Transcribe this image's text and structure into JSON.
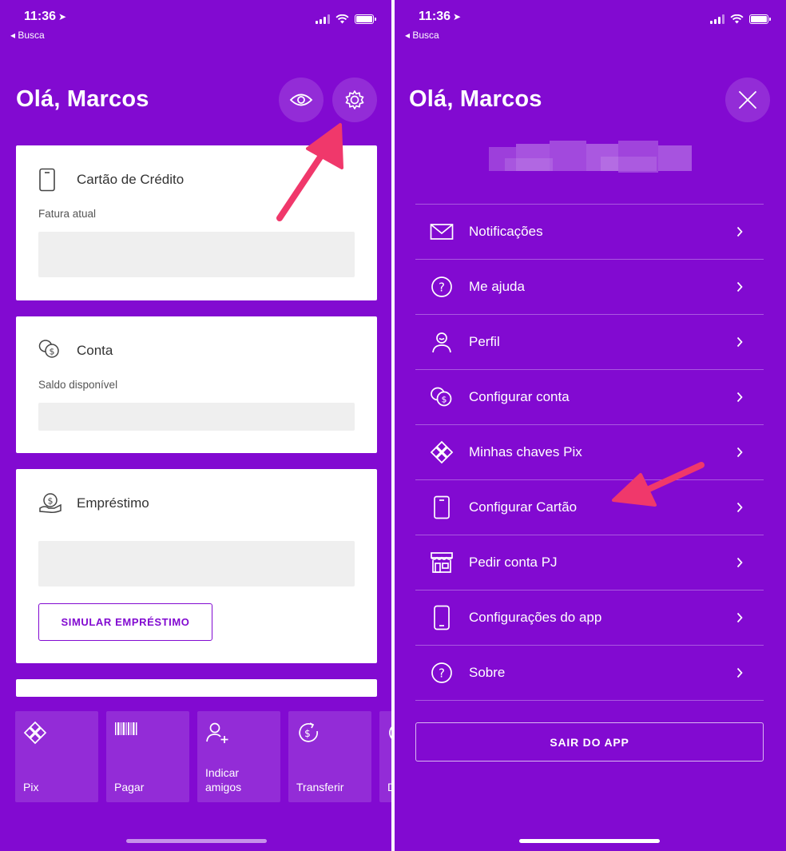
{
  "status_bar": {
    "time": "11:36",
    "back_label": "◂ Busca"
  },
  "left_screen": {
    "greeting": "Olá, Marcos",
    "cards": {
      "credit": {
        "title": "Cartão de Crédito",
        "subtitle": "Fatura atual"
      },
      "account": {
        "title": "Conta",
        "subtitle": "Saldo disponível"
      },
      "loan": {
        "title": "Empréstimo",
        "button_label": "SIMULAR EMPRÉSTIMO"
      }
    },
    "shortcuts": [
      {
        "label": "Pix",
        "icon": "pix-icon"
      },
      {
        "label": "Pagar",
        "icon": "barcode-icon"
      },
      {
        "label": "Indicar amigos",
        "icon": "add-user-icon"
      },
      {
        "label": "Transferir",
        "icon": "transfer-icon"
      },
      {
        "label": "D",
        "icon": "partial-icon"
      }
    ]
  },
  "right_screen": {
    "greeting": "Olá, Marcos",
    "menu": [
      {
        "label": "Notificações",
        "icon": "envelope-icon"
      },
      {
        "label": "Me ajuda",
        "icon": "help-icon"
      },
      {
        "label": "Perfil",
        "icon": "user-icon"
      },
      {
        "label": "Configurar conta",
        "icon": "coins-icon"
      },
      {
        "label": "Minhas chaves Pix",
        "icon": "pix-icon"
      },
      {
        "label": "Configurar Cartão",
        "icon": "card-icon"
      },
      {
        "label": "Pedir conta PJ",
        "icon": "store-icon"
      },
      {
        "label": "Configurações do app",
        "icon": "phone-icon"
      },
      {
        "label": "Sobre",
        "icon": "help-icon"
      }
    ],
    "exit_label": "SAIR DO APP"
  },
  "colors": {
    "brand_purple": "#820ad1",
    "annotation_arrow": "#f0386b"
  }
}
